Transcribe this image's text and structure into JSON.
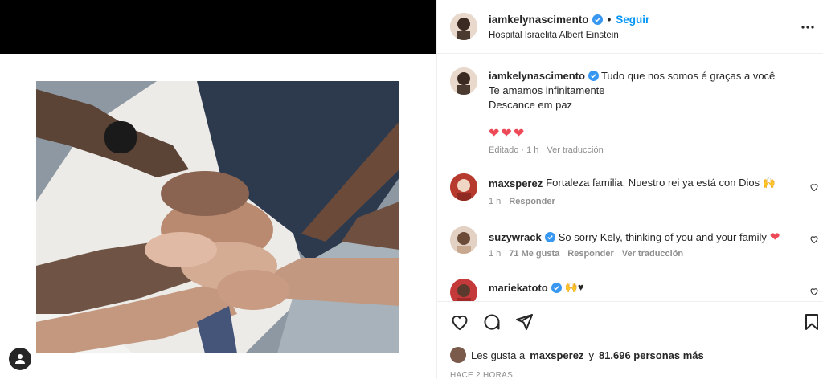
{
  "post": {
    "username": "iamkelynascimento",
    "follow_label": "Seguir",
    "separator": "•",
    "location": "Hospital Israelita Albert Einstein"
  },
  "caption": {
    "username": "iamkelynascimento",
    "line1": "Tudo que nos somos é graças a você",
    "line2": "Te amamos infinitamente",
    "line3": "Descance em paz",
    "hearts": "❤❤❤",
    "edited": "Editado · 1 h",
    "translate": "Ver traducción"
  },
  "comments": [
    {
      "username": "maxsperez",
      "text": "Fortaleza familia. Nuestro rei ya está con Dios 🙌",
      "time": "1 h",
      "reply": "Responder"
    },
    {
      "username": "suzywrack",
      "text": "So sorry Kely, thinking of you and your family",
      "emoji": "❤",
      "time": "1 h",
      "likes": "71 Me gusta",
      "reply": "Responder",
      "translate": "Ver traducción"
    },
    {
      "username": "mariekatoto",
      "text": "🙌♥"
    }
  ],
  "likes": {
    "prefix": "Les gusta a",
    "user": "maxsperez",
    "middle": "y",
    "count": "81.696 personas más"
  },
  "timestamp": "HACE 2 HORAS",
  "colors": {
    "accent": "#0095f6",
    "verified": "#3897f0",
    "heart": "#ed4956"
  }
}
